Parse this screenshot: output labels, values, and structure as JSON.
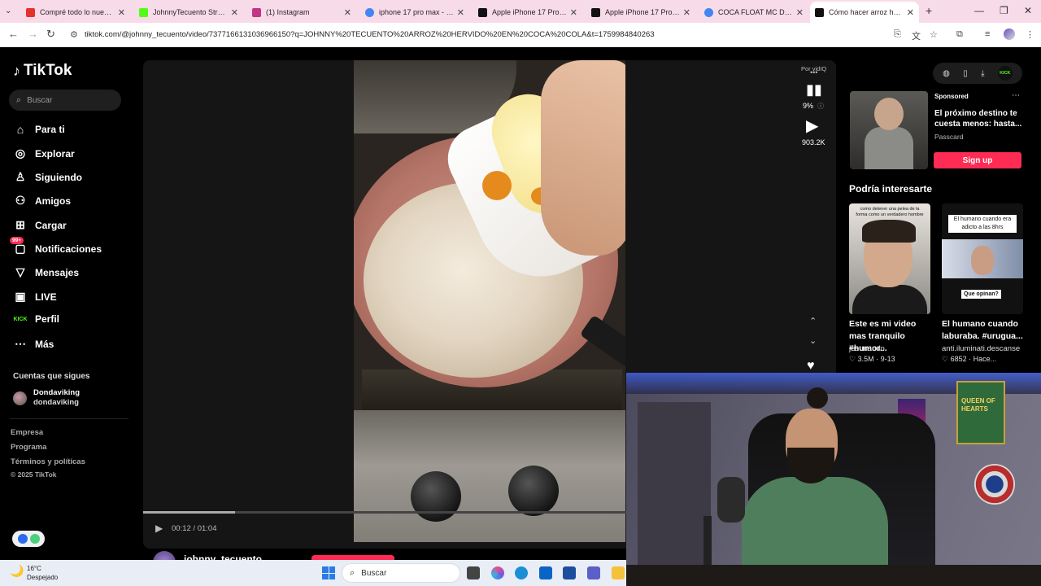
{
  "browser": {
    "tabs": [
      {
        "title": "Compré todo lo nuevo de",
        "color": "#e8312a"
      },
      {
        "title": "JohnnyTecuento Stream",
        "color": "#53fc18"
      },
      {
        "title": "(1) Instagram",
        "color": "#c13584"
      },
      {
        "title": "iphone 17 pro max - Busc",
        "color": "#4285f4"
      },
      {
        "title": "Apple iPhone 17 Pro Max",
        "color": "#111111"
      },
      {
        "title": "Apple iPhone 17 Pro Max",
        "color": "#111111"
      },
      {
        "title": "COCA FLOAT MC DONAL",
        "color": "#4285f4"
      },
      {
        "title": "Cómo hacer arroz hervid",
        "color": "#111111"
      }
    ],
    "url": "tiktok.com/@johnny_tecuento/video/7377166131036966150?q=JOHNNY%20TECUENTO%20ARROZ%20HERVIDO%20EN%20COCA%20COLA&t=1759984840263"
  },
  "sidebar": {
    "logo": "TikTok",
    "search_placeholder": "Buscar",
    "items": [
      {
        "label": "Para ti",
        "icon": "home-icon"
      },
      {
        "label": "Explorar",
        "icon": "compass-icon"
      },
      {
        "label": "Siguiendo",
        "icon": "following-icon"
      },
      {
        "label": "Amigos",
        "icon": "friends-icon"
      },
      {
        "label": "Cargar",
        "icon": "upload-icon"
      },
      {
        "label": "Notificaciones",
        "icon": "inbox-icon",
        "badge": "99+"
      },
      {
        "label": "Mensajes",
        "icon": "send-icon"
      },
      {
        "label": "LIVE",
        "icon": "live-icon"
      },
      {
        "label": "Perfil",
        "icon": "kick-icon"
      },
      {
        "label": "Más",
        "icon": "more-icon"
      }
    ],
    "following_title": "Cuentas que sigues",
    "following": {
      "name": "Dondaviking",
      "handle": "dondaviking"
    },
    "footer": [
      "Empresa",
      "Programa",
      "Términos y políticas"
    ],
    "copyright": "© 2025 TikTok"
  },
  "video": {
    "time_current": "00:12",
    "time_total": "01:04",
    "progress": 0.19,
    "author": "johnny_tecuento",
    "vidiq_label": "Por vidIQ",
    "vidiq_pct": "9%",
    "views": "903.2K"
  },
  "ad": {
    "sponsored": "Sponsored",
    "title": "El próximo destino te cuesta menos: hasta...",
    "brand": "Passcard",
    "cta": "Sign up"
  },
  "suggestions": {
    "heading": "Podría interesarte",
    "items": [
      {
        "title": "Este es mi video mas tranquilo #humor...",
        "author": "jesunando",
        "likes": "3.5M",
        "date": "9-13",
        "caption": "como detener una pelea de la forma como un verdadero hombre"
      },
      {
        "title": "El humano cuando laburaba. #urugua...",
        "author": "anti.iluminati.descanse",
        "likes": "6852",
        "date": "Hace...",
        "caption": "El humano cuando era adicto a las 8hrs",
        "caption2": "Que opinan?"
      }
    ]
  },
  "webcam": {
    "poster_text": "QUEEN OF HEARTS"
  },
  "taskbar": {
    "temp": "16°C",
    "weather": "Despejado",
    "search": "Buscar"
  },
  "accent": "#fe2c55"
}
